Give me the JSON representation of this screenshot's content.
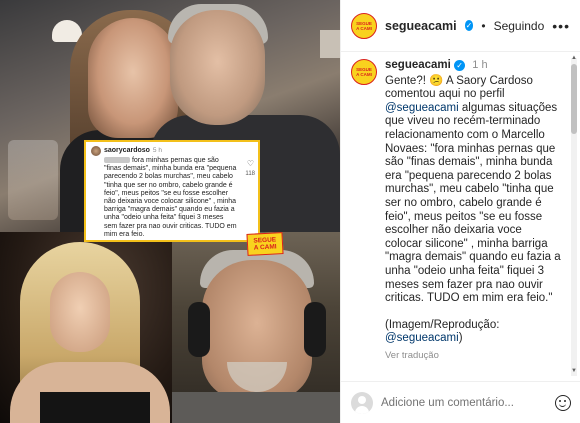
{
  "post": {
    "account": "segueacami",
    "verified_mark": "✓",
    "separator": "•",
    "follow_status": "Seguindo",
    "more_icon": "•••",
    "brand_avatar_lines": [
      "SEGUE",
      "A CAMI"
    ]
  },
  "media": {
    "comment_card": {
      "user": "saorycardoso",
      "time": "5 h",
      "text": "fora minhas pernas que são \"finas demais\", minha bunda era \"pequena parecendo 2 bolas murchas\", meu cabelo \"tinha que ser no ombro, cabelo grande é feio\", meus peitos \"se eu fosse escolher não deixaria voce colocar silicone\" , minha barriga \"magra demais\" quando eu fazia a unha \"odeio unha feita\" fiquei 3 meses sem fazer pra nao ouvir criticas. TUDO em mim era feio.",
      "heart_icon": "♡",
      "likes": "118"
    },
    "logo_lines": [
      "SEGUE",
      "A CAMI"
    ]
  },
  "caption": {
    "user": "segueacami",
    "time": "1 h",
    "text_before_mention": "Gente?! 😕 A Saory Cardoso comentou aqui no perfil ",
    "mention": "@segueacami",
    "text_after_mention": " algumas situações que viveu no recém-terminado relacionamento com o Marcello Novaes: \"fora minhas pernas que são \"finas demais\", minha bunda era \"pequena parecendo 2 bolas murchas\", meu cabelo \"tinha que ser no ombro, cabelo grande é feio\", meus peitos \"se eu fosse escolher não deixaria voce colocar silicone\" , minha barriga \"magra demais\" quando eu fazia a unha \"odeio unha feita\" fiquei 3 meses sem fazer pra nao ouvir criticas. TUDO em mim era feio.\"",
    "credit_before": "(Imagem/Reprodução: ",
    "credit_mention": "@segueacami",
    "credit_after": ")",
    "translate_label": "Ver tradução"
  },
  "scroll": {
    "up_icon": "▲",
    "down_icon": "▼"
  },
  "comment_box": {
    "placeholder": "Adicione um comentário..."
  },
  "colors": {
    "accent_yellow": "#f9d21e",
    "accent_red": "#d9221c",
    "verified_blue": "#0095f6",
    "mention_blue": "#00376b"
  }
}
